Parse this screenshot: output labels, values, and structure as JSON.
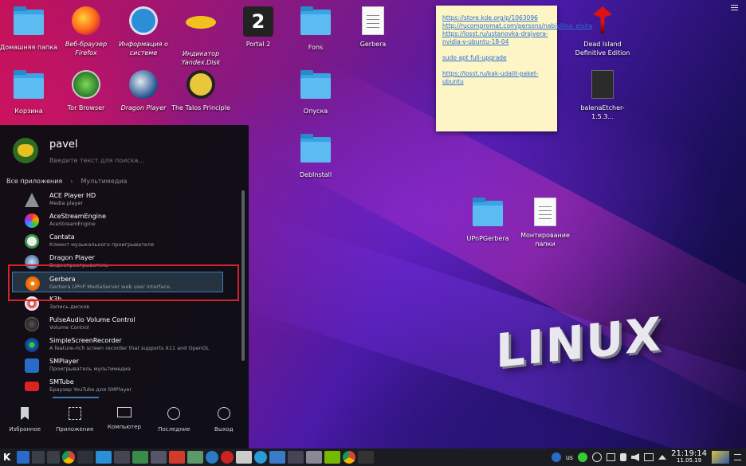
{
  "desktop": {
    "icons": [
      {
        "label": "Домашняя папка",
        "italic": false
      },
      {
        "label": "Веб-браузер Firefox",
        "italic": true
      },
      {
        "label": "Информация о системе",
        "italic": true
      },
      {
        "label": "Индикатор Yandex.Disk",
        "italic": true
      },
      {
        "label": "Portal 2",
        "italic": false
      },
      {
        "label": "Fons",
        "italic": false
      },
      {
        "label": "Gerbera",
        "italic": false
      },
      {
        "label": "Dead Island Definitive Edition",
        "italic": false
      },
      {
        "label": "Корзина",
        "italic": false
      },
      {
        "label": "Tor Browser",
        "italic": false
      },
      {
        "label": "Dragon Player",
        "italic": true
      },
      {
        "label": "The Talos Principle",
        "italic": false
      },
      {
        "label": "Опуска",
        "italic": false
      },
      {
        "label": "balenaEtcher-1.5.3...",
        "italic": false
      },
      {
        "label": "DebInstall",
        "italic": false
      },
      {
        "label": "UPnPGerbera",
        "italic": false
      },
      {
        "label": "Монтирование папки",
        "italic": false
      }
    ],
    "logo_text": "LINUX"
  },
  "note": {
    "link1": "https://store.kde.org/p/1063096",
    "link2": "http://rucompromat.com/persons/nabiullina_elvira",
    "link3": "https://losst.ru/ustanovka-drajvera-nvidia-v-ubuntu-18-04",
    "cmd": "sudo apt full-upgrade",
    "link4": "https://losst.ru/kak-udalit-paket-ubuntu"
  },
  "launcher": {
    "user": "pavel",
    "search_placeholder": "Введите текст для поиска...",
    "breadcrumb_root": "Все приложения",
    "breadcrumb_sep": "›",
    "breadcrumb_current": "Мультимедиа",
    "apps": [
      {
        "name": "ACE Player HD",
        "desc": "Media player"
      },
      {
        "name": "AceStreamEngine",
        "desc": "AceStreamEngine"
      },
      {
        "name": "Cantata",
        "desc": "Клиент музыкального проигрывателя"
      },
      {
        "name": "Dragon Player",
        "desc": "Видеопроигрыватель"
      },
      {
        "name": "Gerbera",
        "desc": "Gerbera UPnP MediaServer web user interface."
      },
      {
        "name": "K3b",
        "desc": "Запись дисков"
      },
      {
        "name": "PulseAudio Volume Control",
        "desc": "Volume Control"
      },
      {
        "name": "SimpleScreenRecorder",
        "desc": "A feature-rich screen recorder that supports X11 and OpenGL"
      },
      {
        "name": "SMPlayer",
        "desc": "Проигрыватель мультимедиа"
      },
      {
        "name": "SMTube",
        "desc": "Браузер YouTube для SMPlayer"
      }
    ],
    "tabs": [
      "Избранное",
      "Приложения",
      "Компьютер",
      "Последние",
      "Выход"
    ]
  },
  "taskbar": {
    "keyboard_layout": "us",
    "time": "21:19:14",
    "date": "11.05.19"
  }
}
